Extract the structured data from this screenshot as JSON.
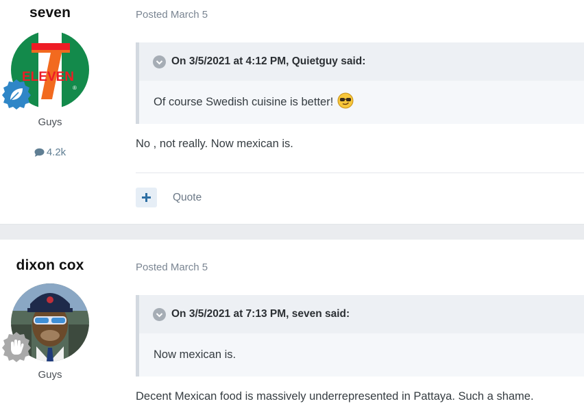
{
  "posts": [
    {
      "author": "seven",
      "group": "Guys",
      "post_count": "4.2k",
      "posted": "Posted March 5",
      "quote_header": "On 3/5/2021 at 4:12 PM, Quietguy said:",
      "quote_text": "Of course Swedish cuisine is better!",
      "body": "No , not really. Now mexican is.",
      "avatar_text": "ELEVEN",
      "avatar_text_2": "7",
      "actions": {
        "quote": "Quote",
        "multiquote": "+"
      }
    },
    {
      "author": "dixon cox",
      "group": "Guys",
      "posted": "Posted March 5",
      "quote_header": "On 3/5/2021 at 7:13 PM, seven said:",
      "quote_text": "Now mexican is.",
      "body": "Decent Mexican food is massively underrepresented in Pattaya. Such a shame."
    }
  ],
  "colors": {
    "rank_blue": "#2f86c7",
    "rank_grey": "#a9a9a9",
    "accent": "#2d6fa3"
  },
  "icons": [
    "leaf-rank-icon",
    "hand-rank-icon",
    "comment-icon",
    "chevron-down-icon",
    "plus-icon",
    "cool-emoji-icon"
  ]
}
